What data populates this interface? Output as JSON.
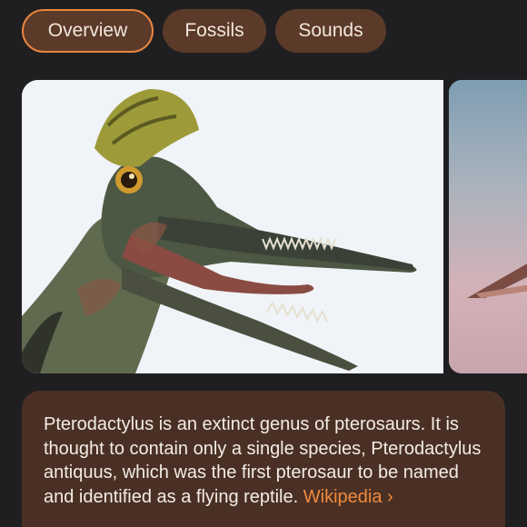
{
  "tabs": [
    {
      "label": "Overview",
      "active": true
    },
    {
      "label": "Fossils",
      "active": false
    },
    {
      "label": "Sounds",
      "active": false
    }
  ],
  "images": [
    {
      "subject": "pterodactylus-head"
    },
    {
      "subject": "pterosaur-sky"
    }
  ],
  "description": {
    "text": "Pterodactylus is an extinct genus of pterosaurs. It is thought to contain only a single species, Pterodactylus antiquus, which was the first pterosaur to be named and identified as a flying reptile.",
    "source_label": "Wikipedia",
    "source_arrow": "›"
  },
  "colors": {
    "background": "#1f1f21",
    "chip": "#5b3a29",
    "chip_active_border": "#e8843f",
    "card": "#4a3024",
    "link": "#f08a3c"
  }
}
